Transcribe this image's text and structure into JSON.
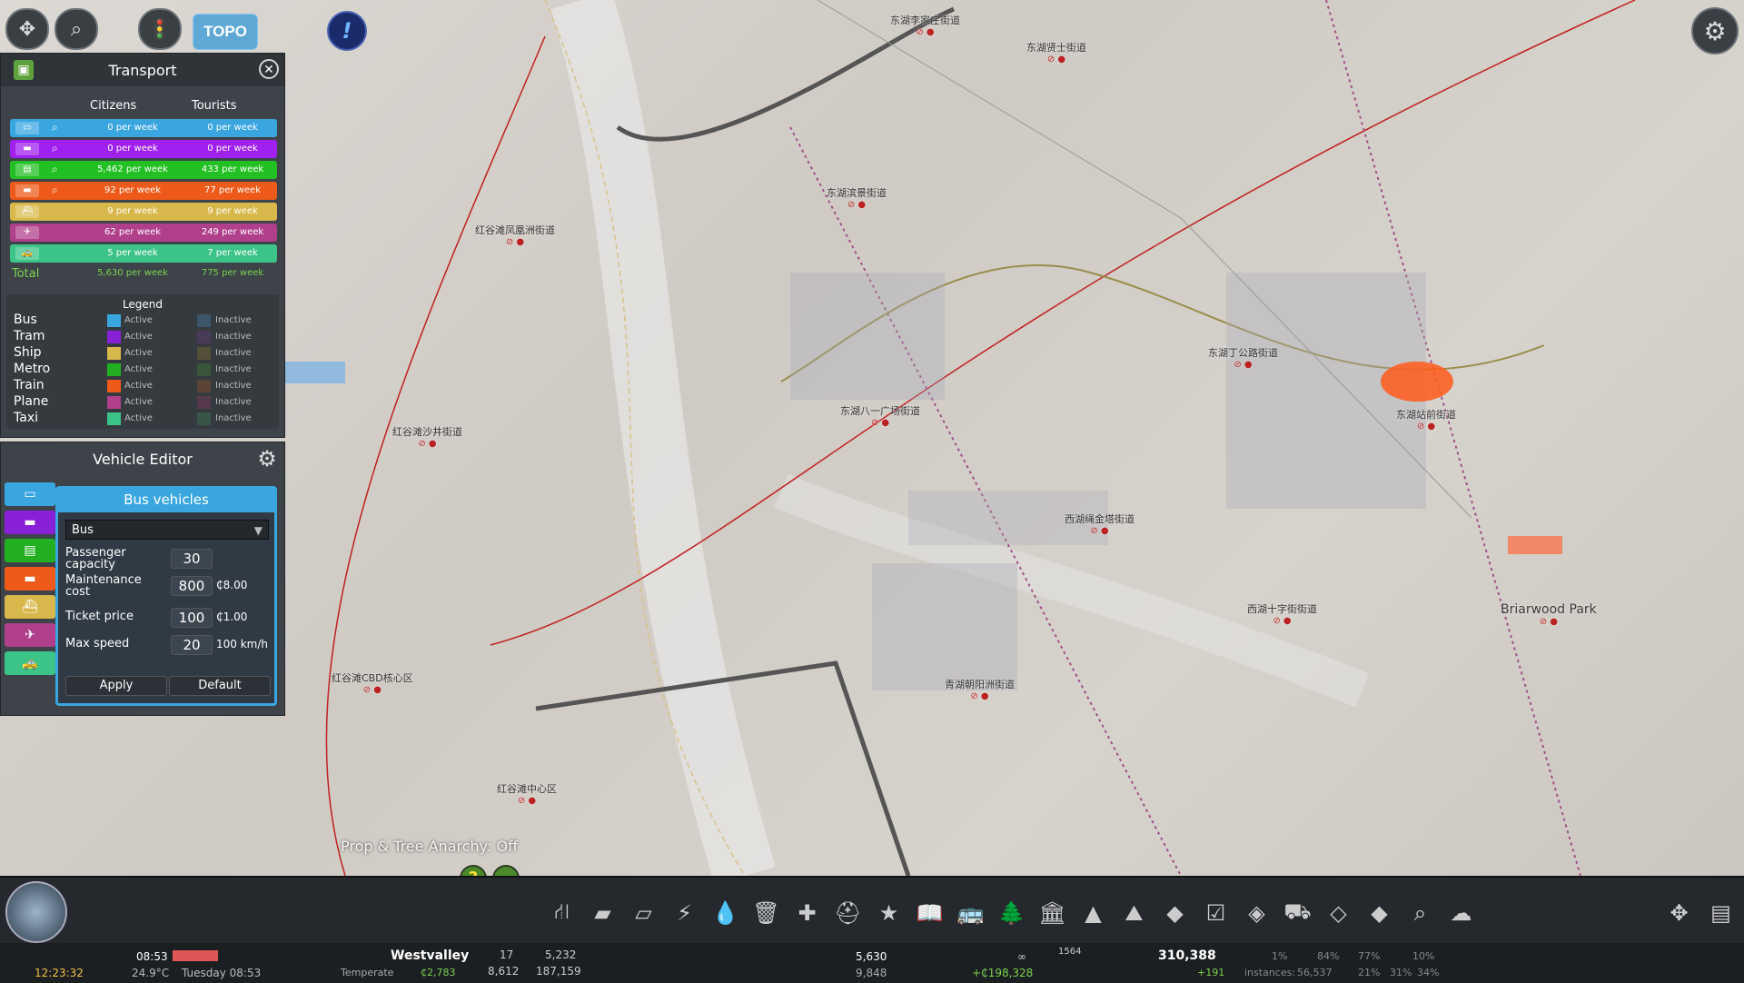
{
  "topbar": {
    "topo_label": "TOPO",
    "icons": [
      "move-tool-icon",
      "search-icon",
      "traffic-light-icon",
      "info-icon",
      "settings-icon"
    ]
  },
  "map_labels": [
    {
      "text": "东湖李家庄街道"
    },
    {
      "text": "东湖贤士街道"
    },
    {
      "text": "东湖滨景街道"
    },
    {
      "text": "红谷滩凤凰洲街道"
    },
    {
      "text": "东湖丁公路街道"
    },
    {
      "text": "东湖八一广场街道"
    },
    {
      "text": "东湖站前街道"
    },
    {
      "text": "红谷滩沙井街道"
    },
    {
      "text": "西湖绳金塔街道"
    },
    {
      "text": "西湖十字街街道"
    },
    {
      "text": "Briarwood Park"
    },
    {
      "text": "红谷滩CBD核心区"
    },
    {
      "text": "青湖朝阳洲街道"
    },
    {
      "text": "红谷滩中心区"
    }
  ],
  "transport": {
    "title": "Transport",
    "col_citizens": "Citizens",
    "col_tourists": "Tourists",
    "rows": [
      {
        "mode": "bus",
        "color": "#3aa6e0",
        "citizens": "0 per week",
        "tourists": "0 per week"
      },
      {
        "mode": "tram",
        "color": "#a020f0",
        "citizens": "0 per week",
        "tourists": "0 per week"
      },
      {
        "mode": "metro",
        "color": "#22c022",
        "citizens": "5,462 per week",
        "tourists": "433 per week"
      },
      {
        "mode": "train",
        "color": "#ee5a1a",
        "citizens": "92 per week",
        "tourists": "77 per week"
      },
      {
        "mode": "ship",
        "color": "#d8b84a",
        "citizens": "9 per week",
        "tourists": "9 per week"
      },
      {
        "mode": "plane",
        "color": "#b0408c",
        "citizens": "62 per week",
        "tourists": "249 per week"
      },
      {
        "mode": "taxi",
        "color": "#3cc488",
        "citizens": "5 per week",
        "tourists": "7 per week"
      }
    ],
    "total": {
      "label": "Total",
      "citizens": "5,630 per week",
      "tourists": "775 per week"
    },
    "legend": {
      "title": "Legend",
      "active_label": "Active",
      "inactive_label": "Inactive",
      "items": [
        {
          "name": "Bus",
          "active": "#3aa6e0",
          "inactive": "#3d5566"
        },
        {
          "name": "Tram",
          "active": "#8a1fd8",
          "inactive": "#493a58"
        },
        {
          "name": "Ship",
          "active": "#d8b84a",
          "inactive": "#55503a"
        },
        {
          "name": "Metro",
          "active": "#22b022",
          "inactive": "#3a553a"
        },
        {
          "name": "Train",
          "active": "#ee5a1a",
          "inactive": "#5a4438"
        },
        {
          "name": "Plane",
          "active": "#b0408c",
          "inactive": "#553a4c"
        },
        {
          "name": "Taxi",
          "active": "#3cc488",
          "inactive": "#3a5548"
        }
      ]
    }
  },
  "vehicle_editor": {
    "title": "Vehicle Editor",
    "section_title": "Bus vehicles",
    "selected_vehicle": "Bus",
    "fields": [
      {
        "label": "Passenger capacity",
        "value": "30",
        "unit": ""
      },
      {
        "label": "Maintenance cost",
        "value": "800",
        "unit": "₵8.00"
      },
      {
        "label": "Ticket price",
        "value": "100",
        "unit": "₵1.00"
      },
      {
        "label": "Max speed",
        "value": "20",
        "unit": "100 km/h"
      }
    ],
    "apply_label": "Apply",
    "default_label": "Default",
    "tabs": [
      {
        "mode": "bus",
        "color": "#3aa6e0"
      },
      {
        "mode": "tram",
        "color": "#8a1fd8"
      },
      {
        "mode": "metro",
        "color": "#22b022"
      },
      {
        "mode": "train",
        "color": "#ee5a1a"
      },
      {
        "mode": "ship",
        "color": "#d8b84a"
      },
      {
        "mode": "plane",
        "color": "#b0408c"
      },
      {
        "mode": "taxi",
        "color": "#3cc488"
      }
    ]
  },
  "overlay": {
    "anarchy": "Prop & Tree Anarchy: Off",
    "help": "?",
    "minus": "–"
  },
  "status": {
    "clock": "12:23:32",
    "time": "08:53",
    "temp": "24.9°C",
    "date": "Tuesday 08:53",
    "city": "Westvalley",
    "climate": "Temperate",
    "money": "₵2,783",
    "val_17": "17",
    "val_8612": "8,612",
    "val_5232": "5,232",
    "val_187159": "187,159",
    "trips": "5,630",
    "trips2": "9,848",
    "income": "+₵198,328",
    "infinity": "∞",
    "val_1564": "1564",
    "population": "310,388",
    "pop_delta": "+191",
    "instances": "instances:",
    "pct1": "1%",
    "inst_count": "56,537",
    "pct2": "84%",
    "pct3": "21%",
    "pct4": "77%",
    "pct5": "31%",
    "pct6": "10%",
    "pct7": "34%"
  }
}
